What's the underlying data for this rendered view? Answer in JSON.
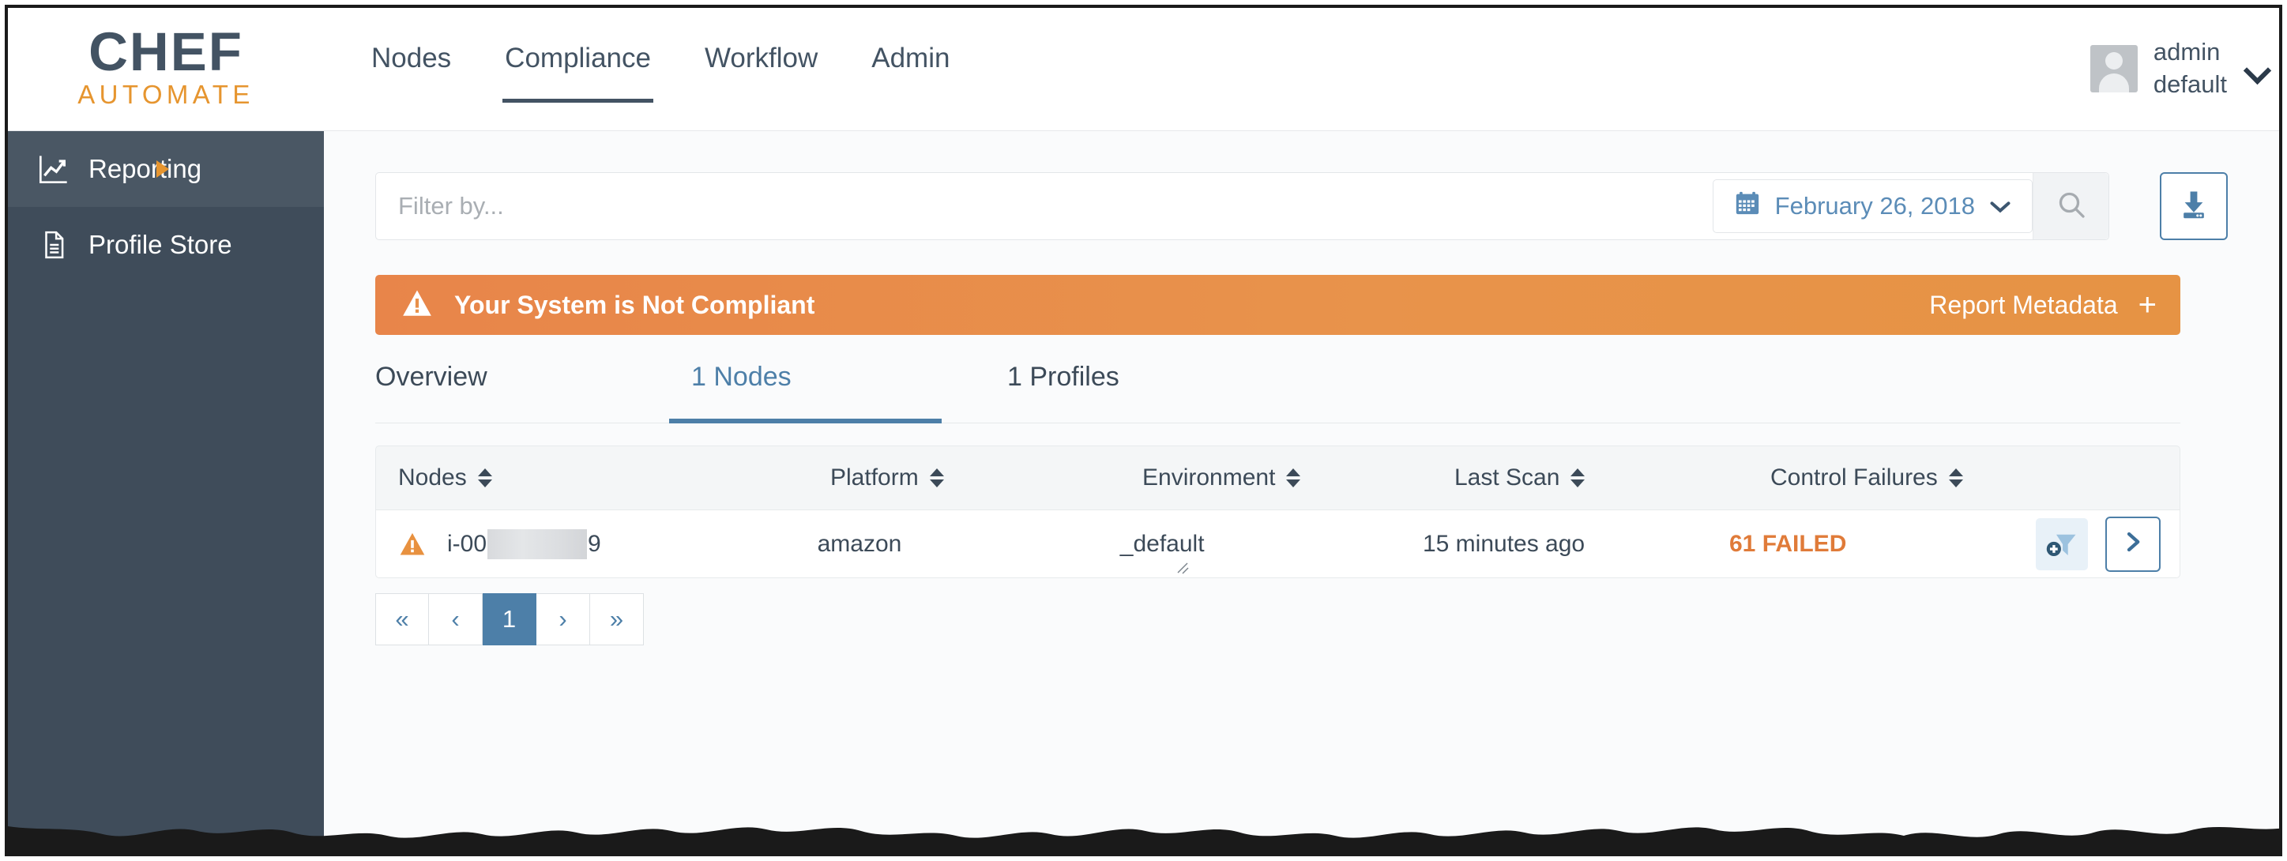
{
  "app": {
    "logo_primary": "CHEF",
    "logo_secondary": "AUTOMATE"
  },
  "topnav": {
    "links": [
      {
        "label": "Nodes",
        "active": false
      },
      {
        "label": "Compliance",
        "active": true
      },
      {
        "label": "Workflow",
        "active": false
      },
      {
        "label": "Admin",
        "active": false
      }
    ],
    "user": {
      "name": "admin",
      "org": "default",
      "caret_icon": "chevron-down-icon",
      "avatar_icon": "user-avatar-icon"
    }
  },
  "sidebar": {
    "items": [
      {
        "label": "Reporting",
        "icon": "chart-line-icon",
        "selected": true,
        "has_arrow": true
      },
      {
        "label": "Profile Store",
        "icon": "document-icon",
        "selected": false,
        "has_arrow": false
      }
    ]
  },
  "filterbar": {
    "placeholder": "Filter by...",
    "value": "",
    "date_label": "February 26, 2018",
    "calendar_icon": "calendar-icon",
    "date_caret_icon": "chevron-down-icon",
    "search_icon": "search-icon",
    "download_icon": "download-icon"
  },
  "alert": {
    "warning_icon": "warning-triangle-icon",
    "message": "Your System is Not Compliant",
    "metadata_label": "Report Metadata",
    "metadata_toggle": "+",
    "color": "#e8904a"
  },
  "tabs": [
    {
      "label": "Overview",
      "active": false
    },
    {
      "label": "1 Nodes",
      "active": true
    },
    {
      "label": "1 Profiles",
      "active": false
    }
  ],
  "table": {
    "columns": [
      {
        "label": "Nodes",
        "sort_icon": "sort-updown-icon"
      },
      {
        "label": "Platform",
        "sort_icon": "sort-updown-icon"
      },
      {
        "label": "Environment",
        "sort_icon": "sort-updown-icon"
      },
      {
        "label": "Last Scan",
        "sort_icon": "sort-updown-icon"
      },
      {
        "label": "Control Failures",
        "sort_icon": "sort-updown-icon"
      }
    ],
    "rows": [
      {
        "status_icon": "warning-triangle-icon",
        "node_prefix": "i-00",
        "node_redacted": true,
        "node_suffix": "9",
        "platform": "amazon",
        "environment": "_default",
        "last_scan": "15 minutes ago",
        "control_failures": "61 FAILED",
        "failure_color": "#e07b39",
        "add_filter_icon": "add-filter-funnel-icon",
        "detail_icon": "chevron-right-icon"
      }
    ]
  },
  "pagination": {
    "first_label": "«",
    "prev_label": "‹",
    "pages": [
      "1"
    ],
    "current_page": "1",
    "next_label": "›",
    "last_label": "»"
  }
}
